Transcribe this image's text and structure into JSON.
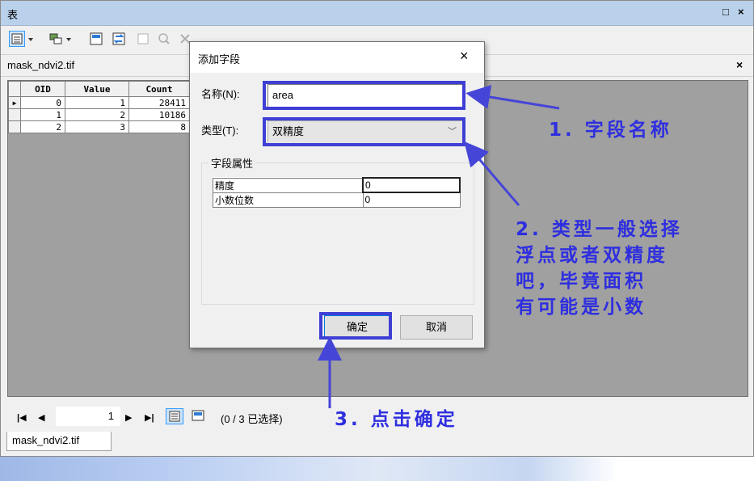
{
  "window": {
    "title": "表",
    "controls": [
      "□",
      "×"
    ]
  },
  "table_tab": {
    "name": "mask_ndvi2.tif",
    "close": "×"
  },
  "attribute_table": {
    "columns": [
      "OID",
      "Value",
      "Count"
    ],
    "rows": [
      {
        "oid": "0",
        "value": "1",
        "count": "28411"
      },
      {
        "oid": "1",
        "value": "2",
        "count": "10186"
      },
      {
        "oid": "2",
        "value": "3",
        "count": "8"
      }
    ]
  },
  "navigator": {
    "first": "⏮",
    "prev": "◀",
    "record": "1",
    "next": "▶",
    "last": "⏭",
    "selection": "(0 / 3 已选择)"
  },
  "bottom_tab": "mask_ndvi2.tif",
  "dialog": {
    "title": "添加字段",
    "close": "×",
    "name_label": "名称(N):",
    "name_value": "area",
    "type_label": "类型(T):",
    "type_value": "双精度",
    "props_label": "字段属性",
    "props": [
      {
        "key": "精度",
        "value": "0"
      },
      {
        "key": "小数位数",
        "value": "0"
      }
    ],
    "ok": "确定",
    "cancel": "取消"
  },
  "annotations": {
    "step1": "1. 字段名称",
    "step2": [
      "2. 类型一般选择",
      "浮点或者双精度",
      "吧，毕竟面积",
      "有可能是小数"
    ],
    "step3": "3. 点击确定"
  },
  "colors": {
    "annotation": "#2e2ee0",
    "titlebar": "#b9d1ea",
    "dialog_bg": "#f0f0f0"
  }
}
